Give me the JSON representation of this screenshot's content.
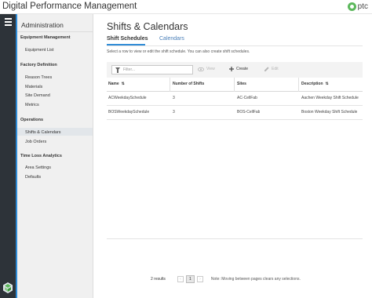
{
  "app": {
    "title": "Digital Performance Management",
    "logo_text": "ptc",
    "accent": "#2e8bd6"
  },
  "sidebar": {
    "title": "Administration",
    "groups": [
      {
        "label": "Equipment Management",
        "items": [
          "Equipment List"
        ]
      },
      {
        "label": "Factory Definition",
        "items": [
          "Reason Trees",
          "Materials",
          "Site Demand",
          "Metrics"
        ]
      },
      {
        "label": "Operations",
        "items": [
          "Shifts & Calendars",
          "Job Orders"
        ]
      },
      {
        "label": "Time Loss Analytics",
        "items": [
          "Area Settings",
          "Defaults"
        ]
      }
    ],
    "active_item": "Shifts & Calendars"
  },
  "page": {
    "title": "Shifts & Calendars",
    "tabs": [
      {
        "label": "Shift Schedules",
        "active": true
      },
      {
        "label": "Calendars",
        "active": false
      }
    ],
    "description": "Select a row to view or edit the shift schedule. You can also create shift schedules."
  },
  "toolbar": {
    "filter_placeholder": "Filter...",
    "view_label": "View",
    "create_label": "Create",
    "edit_label": "Edit"
  },
  "table": {
    "columns": [
      "Name",
      "Number of Shifts",
      "Sites",
      "Description"
    ],
    "rows": [
      [
        "ACWeekdaySchedule",
        "3",
        "AC-CellFab",
        "Aachen Weekday Shift Schedule"
      ],
      [
        "BOSWeekdaySchedule",
        "3",
        "BOS-CellFab",
        "Boston Weekday Shift Schedule"
      ]
    ]
  },
  "pagination": {
    "results": "2 results",
    "current_page": "1",
    "note": "Note: Moving between pages clears any selections."
  }
}
